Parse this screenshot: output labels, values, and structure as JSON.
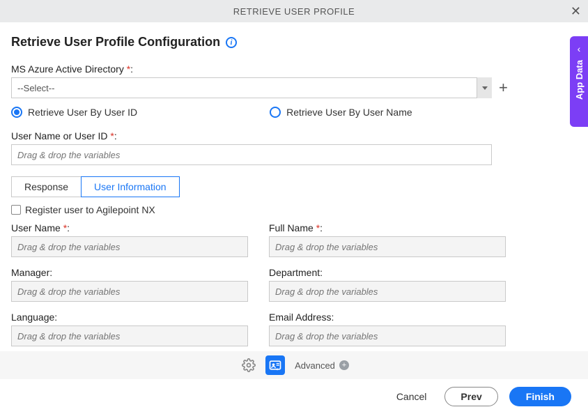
{
  "titlebar": {
    "title": "RETRIEVE USER PROFILE"
  },
  "page": {
    "title": "Retrieve User Profile Configuration"
  },
  "fields": {
    "azure_label": "MS Azure Active Directory ",
    "azure_select_value": "--Select--",
    "user_id_or_name_label": "User Name or User ID ",
    "drag_placeholder": "Drag & drop the variables"
  },
  "radio": {
    "by_id": "Retrieve User By User ID",
    "by_name": "Retrieve User By User Name"
  },
  "tabs": {
    "response": "Response",
    "user_info": "User Information"
  },
  "checkbox": {
    "register": "Register user to Agilepoint NX"
  },
  "userinfo": {
    "user_name": "User Name ",
    "full_name": "Full Name ",
    "manager": "Manager:",
    "department": "Department:",
    "language": "Language:",
    "email": "Email Address:"
  },
  "footer": {
    "advanced": "Advanced",
    "cancel": "Cancel",
    "prev": "Prev",
    "finish": "Finish"
  },
  "side": {
    "label": "App Data"
  }
}
